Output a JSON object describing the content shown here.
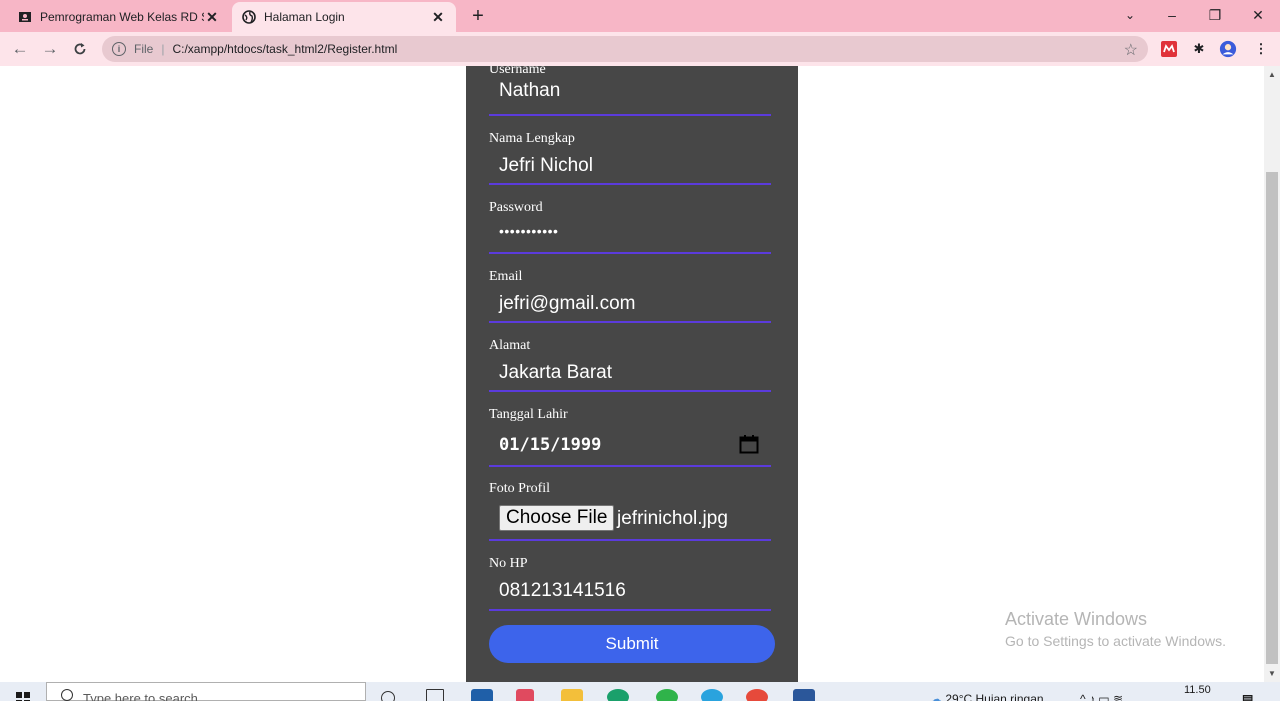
{
  "browser": {
    "tabs": [
      {
        "title": "Pemrograman Web Kelas RD Sem",
        "active": false
      },
      {
        "title": "Halaman Login",
        "active": true
      }
    ],
    "new_tab": "+",
    "window_controls": {
      "minimize": "–",
      "maximize": "❐",
      "close": "✕"
    },
    "address": {
      "scheme": "File",
      "url": "C:/xampp/htdocs/task_html2/Register.html"
    }
  },
  "form": {
    "fields": [
      {
        "label": "Username",
        "value": "Nathan"
      },
      {
        "label": "Nama Lengkap",
        "value": "Jefri Nichol"
      },
      {
        "label": "Password",
        "value": "•••••••••••"
      },
      {
        "label": "Email",
        "value": "jefri@gmail.com"
      },
      {
        "label": "Alamat",
        "value": "Jakarta Barat"
      },
      {
        "label": "Tanggal Lahir",
        "value": "01/15/1999"
      },
      {
        "label": "Foto Profil",
        "button": "Choose File",
        "value": "jefrinichol.jpg"
      },
      {
        "label": "No HP",
        "value": "081213141516"
      }
    ],
    "submit_label": "Submit"
  },
  "watermark": {
    "line1": "Activate Windows",
    "line2": "Go to Settings to activate Windows."
  },
  "taskbar": {
    "search_placeholder": "Type here to search",
    "weather": "29°C  Hujan ringan",
    "time": "11.50"
  },
  "colors": {
    "tabstrip": "#f7b6c6",
    "toolbar": "#fde4ea",
    "form_bg": "#474747",
    "underline": "#5b3bdc",
    "submit": "#3d64eb"
  }
}
